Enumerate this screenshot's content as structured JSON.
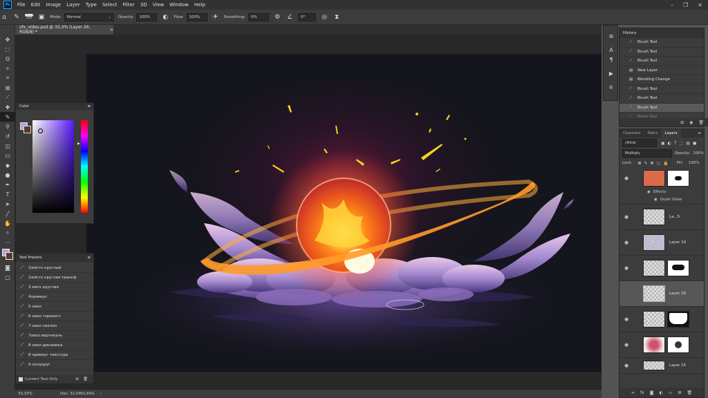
{
  "menu": {
    "logo": "Ps",
    "items": [
      "File",
      "Edit",
      "Image",
      "Layer",
      "Type",
      "Select",
      "Filter",
      "3D",
      "View",
      "Window",
      "Help"
    ]
  },
  "options": {
    "brush_size": "300",
    "mode_label": "Mode:",
    "mode_value": "Normal",
    "opacity_label": "Opacity:",
    "opacity_value": "100%",
    "flow_label": "Flow:",
    "flow_value": "100%",
    "smoothing_label": "Smoothing:",
    "smoothing_value": "0%",
    "angle_value": "0°"
  },
  "document": {
    "tab_title": "vfx_video.psd @ 33,3% (Layer 26, RGB/8) *"
  },
  "status": {
    "zoom": "33,33%",
    "doc_info": "Doc: 32,0M/1,65G"
  },
  "color_panel": {
    "title": "Color"
  },
  "tool_presets": {
    "title": "Tool Presets",
    "items": [
      "2жёстк круглый",
      "2жёстк круглая трансф",
      "3 мягк круглая",
      "4прямоуг",
      "5 овал",
      "6 овал горизонт",
      "7 овал наклон",
      "7овал вертикаль",
      "8 овал динамика",
      "8 прямоуг текстура",
      "9 полукруг"
    ],
    "current_only": "Current Tool Only"
  },
  "history": {
    "title": "History",
    "items": [
      "Brush Tool",
      "Brush Tool",
      "Brush Tool",
      "New Layer",
      "Blending Change",
      "Brush Tool",
      "Brush Tool",
      "Brush Tool",
      "Brush Tool"
    ],
    "selected_index": 7
  },
  "layers_panel": {
    "tabs": [
      "Channels",
      "Paths",
      "Layers"
    ],
    "active_tab": "Layers",
    "filter_label": "Kind",
    "blend_mode": "Multiply",
    "opacity_label": "Opacity:",
    "opacity_value": "100%",
    "lock_label": "Lock:",
    "fill_label": "Fill:",
    "fill_value": "100%",
    "effects_label": "Effects",
    "outer_glow_label": "Outer Glow",
    "layers": [
      {
        "name": "",
        "selected": false
      },
      {
        "name": "La...5",
        "selected": false
      },
      {
        "name": "Layer 19",
        "selected": false
      },
      {
        "name": "",
        "selected": false
      },
      {
        "name": "Layer 26",
        "selected": true
      },
      {
        "name": "",
        "selected": false
      },
      {
        "name": "",
        "selected": false
      },
      {
        "name": "Layer 15",
        "selected": false
      }
    ]
  },
  "colors": {
    "orb_core": "#fff5a0",
    "orb_fire": "#ff8a1a",
    "orb_shell": "#ff5a2a",
    "ring": "#ffb03a",
    "cloud": "#a58ad0",
    "spark": "#f2d21a",
    "canvas_bg": "#14151d"
  }
}
